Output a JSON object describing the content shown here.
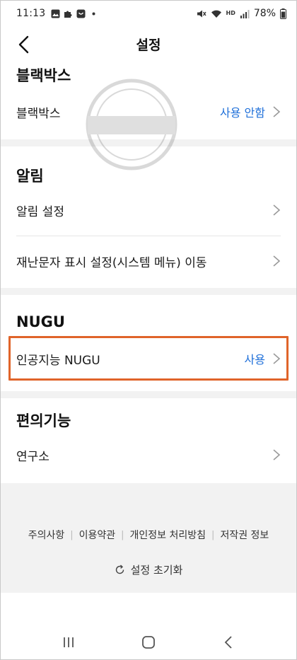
{
  "status_bar": {
    "time": "11:13",
    "battery": "78%",
    "network_label": "HD"
  },
  "header": {
    "title": "설정"
  },
  "sections": {
    "blackbox": {
      "title": "블랙박스",
      "row_label": "블랙박스",
      "row_value": "사용 안함"
    },
    "alarm": {
      "title": "알림",
      "rows": [
        {
          "label": "알림 설정"
        },
        {
          "label": "재난문자 표시 설정(시스템 메뉴) 이동"
        }
      ]
    },
    "nugu": {
      "title": "NUGU",
      "row_label": "인공지능 NUGU",
      "row_value": "사용"
    },
    "convenience": {
      "title": "편의기능",
      "row_label": "연구소"
    }
  },
  "footer": {
    "links": [
      "주의사항",
      "이용약관",
      "개인정보 처리방침",
      "저작권 정보"
    ],
    "reset_label": "설정 초기화"
  },
  "colors": {
    "accent_blue": "#1e6fd9",
    "highlight_orange": "#e0642a",
    "section_gap": "#f2f2f2"
  }
}
